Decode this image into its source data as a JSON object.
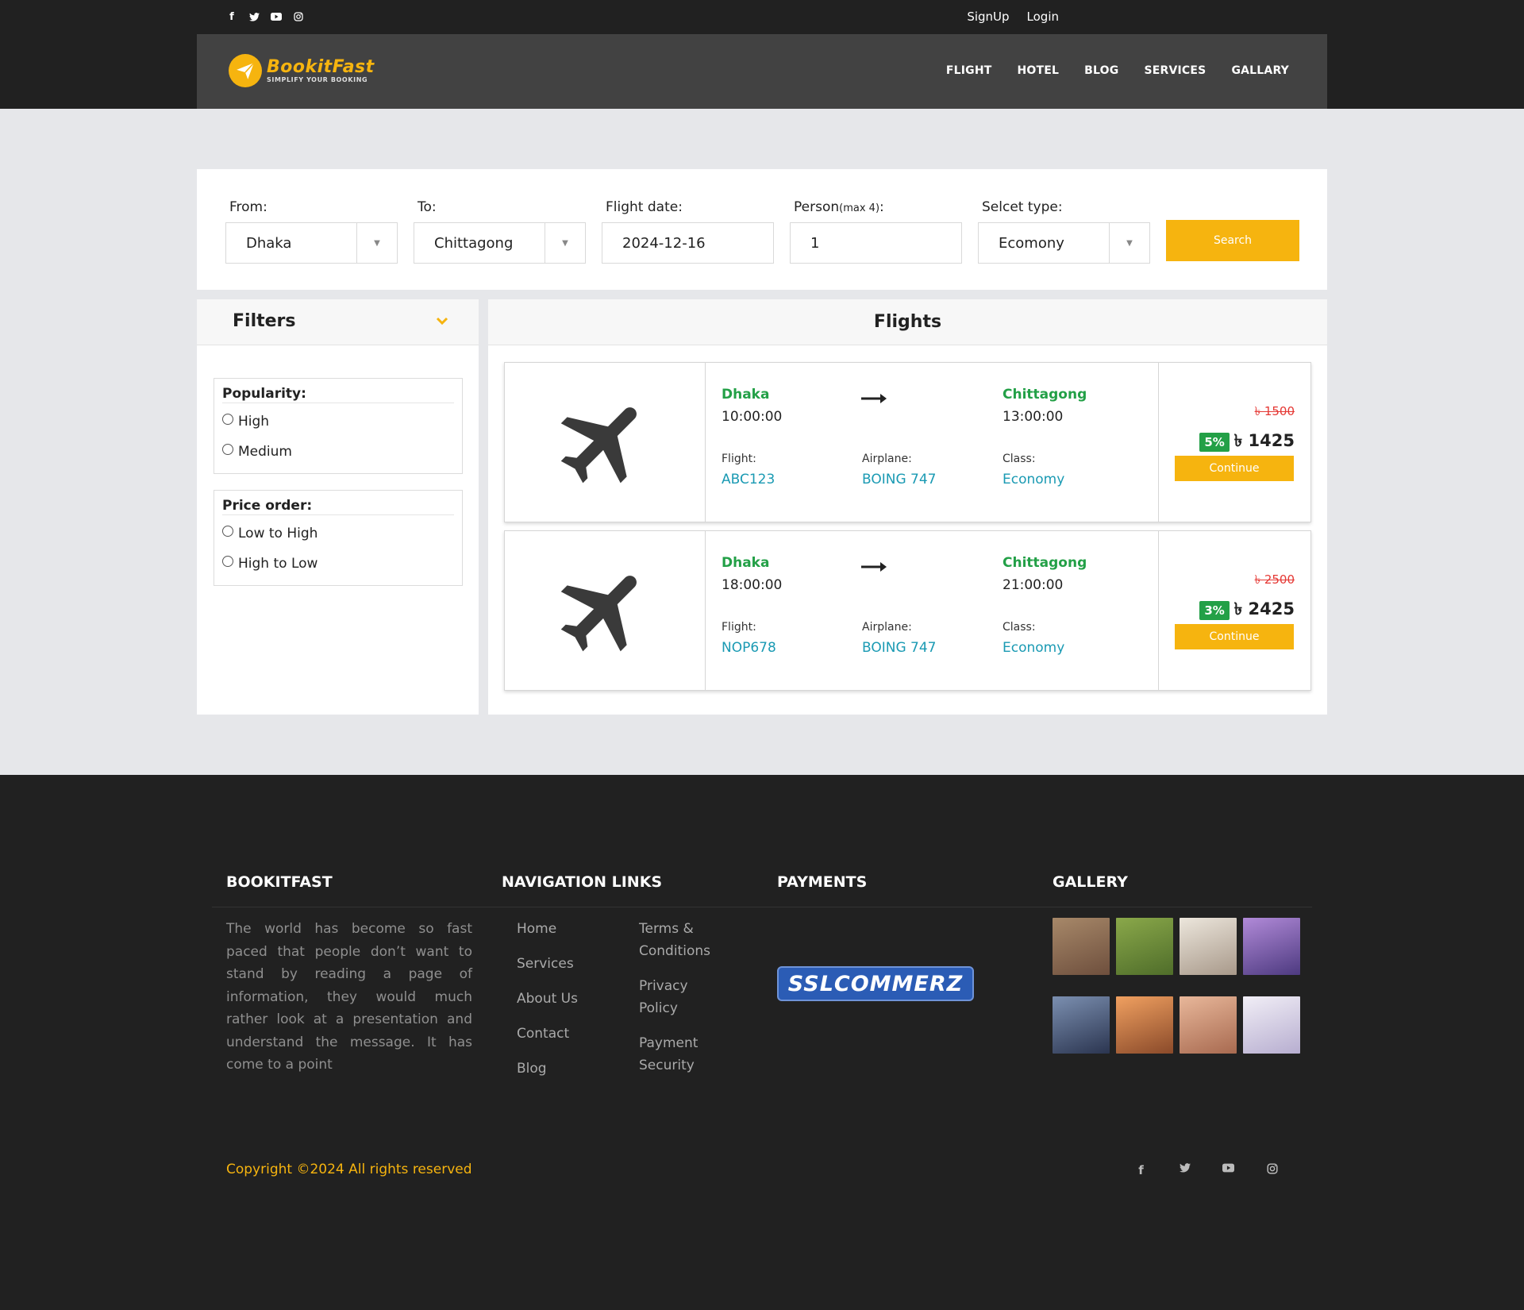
{
  "topbar": {
    "social_icons": [
      "facebook-icon",
      "twitter-icon",
      "youtube-icon",
      "instagram-icon"
    ],
    "signup_label": "SignUp",
    "login_label": "Login"
  },
  "brand": {
    "name": "BookitFast",
    "tagline": "SIMPLIFY YOUR BOOKING",
    "color": "#f6b40f"
  },
  "nav": {
    "items": [
      {
        "label": "FLIGHT"
      },
      {
        "label": "HOTEL"
      },
      {
        "label": "BLOG"
      },
      {
        "label": "SERVICES"
      },
      {
        "label": "GALLARY"
      }
    ]
  },
  "search": {
    "from_label": "From:",
    "from_value": "Dhaka",
    "to_label": "To:",
    "to_value": "Chittagong",
    "date_label": "Flight date:",
    "date_value": "2024-12-16",
    "person_label": "Person",
    "person_label_small": "(max 4)",
    "person_label_suffix": ":",
    "person_value": "1",
    "type_label": "Selcet type:",
    "type_value": "Ecomony",
    "search_button": "Search"
  },
  "filters": {
    "title": "Filters",
    "popularity": {
      "title": "Popularity:",
      "options": [
        "High",
        "Medium"
      ]
    },
    "price_order": {
      "title": "Price order:",
      "options": [
        "Low to High",
        "High to Low"
      ]
    }
  },
  "flights": {
    "title": "Flights",
    "labels": {
      "flight": "Flight:",
      "airplane": "Airplane:",
      "class": "Class:"
    },
    "continue_label": "Continue",
    "items": [
      {
        "from": "Dhaka",
        "from_time": "10:00:00",
        "to": "Chittagong",
        "to_time": "13:00:00",
        "flight": "ABC123",
        "airplane": "BOING 747",
        "class": "Economy",
        "old_price": "৳ 1500",
        "discount": "5%",
        "price": "৳ 1425"
      },
      {
        "from": "Dhaka",
        "from_time": "18:00:00",
        "to": "Chittagong",
        "to_time": "21:00:00",
        "flight": "NOP678",
        "airplane": "BOING 747",
        "class": "Economy",
        "old_price": "৳ 2500",
        "discount": "3%",
        "price": "৳ 2425"
      }
    ]
  },
  "footer": {
    "about_title": "BOOKITFAST",
    "about_text": "The world has become so fast paced that people don’t want to stand by reading a page of information, they would much rather look at a presentation and understand the message. It has come to a point",
    "nav_title": "NAVIGATION LINKS",
    "nav_links_left": [
      "Home",
      "Services",
      "About Us",
      "Contact",
      "Blog"
    ],
    "nav_links_right": [
      "Terms & Conditions",
      "Privacy Policy",
      "Payment Security"
    ],
    "payments_title": "PAYMENTS",
    "payment_logo": "SSLCOMMERZ",
    "gallery_title": "GALLERY",
    "gallery_colors": [
      "#8c6a55",
      "#6f8f3a",
      "#c9bfb2",
      "#6a4f9a",
      "#3d4e6b",
      "#d97a3c",
      "#c98a6e",
      "#c8c4d6"
    ],
    "copyright": "Copyright ©2024 All rights reserved",
    "social_icons": [
      "facebook-icon",
      "twitter-icon",
      "youtube-icon",
      "instagram-icon"
    ]
  }
}
